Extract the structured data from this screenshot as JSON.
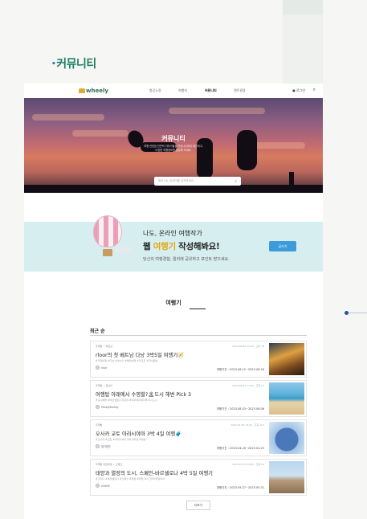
{
  "caption": {
    "bullet": "•",
    "text": "커뮤니티"
  },
  "nav": {
    "logo": "wheely",
    "items": [
      "항공노정",
      "여행지",
      "커뮤니티",
      "렌트관광"
    ],
    "active_index": 2,
    "login": "로그인",
    "search_icon": "search-icon"
  },
  "hero": {
    "title": "커뮤니티",
    "subtitle_line1": "여행 관련된 전반적 이야기들을 커뮤니티에서 확인하고,",
    "subtitle_line2": "다양한 여행정보를 공유해 보세요.",
    "search_placeholder": "원하시는 검색어를 입력하세요.",
    "search_icon": "search-icon"
  },
  "banner": {
    "line1": "나도, 온라인 여행작가",
    "line2_prefix": "웹 ",
    "line2_highlight": "여행기",
    "line2_suffix": " 작성해봐요!",
    "line3": "당신의 여행경험, 릴리에 공유하고 포인트 받으세요.",
    "button": "글쓰기",
    "accent": "#e1a80c",
    "button_color": "#3c9bd8"
  },
  "section": {
    "title": "여행기",
    "sort": "최근 순"
  },
  "posts": [
    {
      "category": "주제별 > 베트남",
      "meta": "2023.08.26 22:00  ·  조회 18",
      "title": "rloor의 첫 베트남 다낭 3박5일 여행기🧭",
      "tags": "#가족여행  #다낭  #아시아  #해외여행  #리조트  #자녀동반",
      "user": "rloor",
      "period": "여행기간 : 2023.06.12~2023.06.16"
    },
    {
      "category": "주제별 > 동남아",
      "meta": "2023.08.24 17:00  ·  조회 27",
      "title": "여행탑 아래에서 수영할?🏝도시 해변 Pick 3",
      "tags": "#도시해변  #바르셀로나  #로마  #리우데자네이루  #시드니",
      "user": "PeekyMonkey",
      "period": "여행기간 : 2023.08.03~2023.08.06"
    },
    {
      "category": "주제별",
      "meta": "2023.07.30 13:00  ·  조회 107",
      "title": "오사카 교토 아라시야마 3박 4일 여행🧳",
      "tags": "#오사카  #교토  #아라시야마  #유니버설  #일본",
      "user": "밀키한잔",
      "period": "여행기간 : 2023.04.20~2023.04.23"
    },
    {
      "category": "주제별 유럽여행 > 스페인",
      "meta": "2023.07.10 09:00  ·  조회 91",
      "title": "태양과 열정의 도시, 스페인-바르셀로나 4박 5일 여행기",
      "tags": "#가우디  #바르셀로나  #스페인  #유럽  #성당  #사그라다파밀리아",
      "user": "ellie00",
      "period": "여행기간 : 2023.05.27~2023.05.31"
    }
  ],
  "more_button": "더보기"
}
